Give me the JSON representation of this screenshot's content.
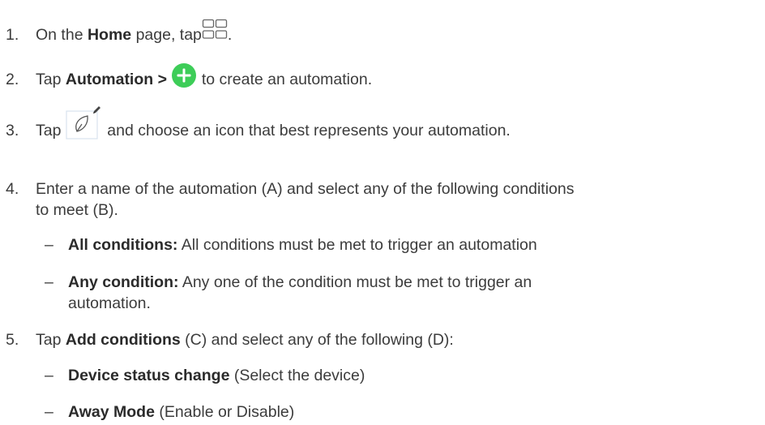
{
  "steps": [
    {
      "number": "1.",
      "p1": "On the ",
      "b1": "Home",
      "p2": " page, tap",
      "p3": ".",
      "icon": "grid-icon"
    },
    {
      "number": "2.",
      "p1": "Tap ",
      "b1": "Automation >",
      "p2": " to create an automation.",
      "icon": "add-circle-icon",
      "icon_color": "#3dcd58"
    },
    {
      "number": "3.",
      "p1": "Tap ",
      "p2": " and choose an icon that best represents your automation.",
      "icon": "leaf-edit-icon"
    },
    {
      "number": "4.",
      "line1": "Enter a name of the automation (A) and select any of the following conditions",
      "line2": "to meet (B).",
      "subs": [
        {
          "dash": "–",
          "b": "All conditions:",
          "t": " All conditions must be met to trigger an automation"
        },
        {
          "dash": "–",
          "b": "Any condition:",
          "t": " Any one of the condition must be met to trigger an",
          "t2": "automation."
        }
      ]
    },
    {
      "number": "5.",
      "p1": "Tap ",
      "b1": "Add conditions",
      "p2": " (C) and select any of the following (D):",
      "subs": [
        {
          "dash": "–",
          "b": "Device status change",
          "t": " (Select the device)"
        },
        {
          "dash": "–",
          "b": "Away Mode",
          "t": " (Enable or Disable)"
        }
      ]
    }
  ]
}
